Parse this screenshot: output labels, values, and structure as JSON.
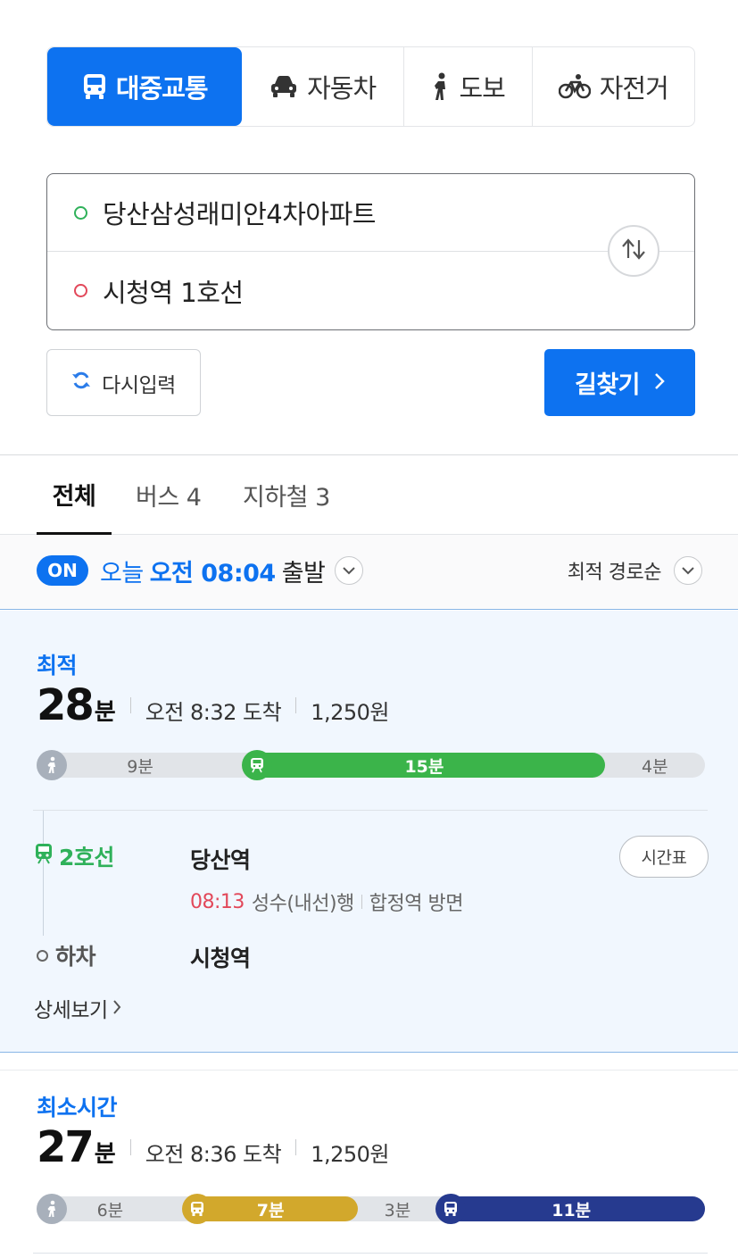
{
  "mode_tabs": [
    {
      "label": "대중교통",
      "icon": "bus-icon",
      "active": true
    },
    {
      "label": "자동차",
      "icon": "car-icon",
      "active": false
    },
    {
      "label": "도보",
      "icon": "walk-icon",
      "active": false
    },
    {
      "label": "자전거",
      "icon": "bicycle-icon",
      "active": false
    }
  ],
  "route": {
    "origin": "당산삼성래미안4차아파트",
    "destination": "시청역 1호선"
  },
  "buttons": {
    "reset": "다시입력",
    "search": "길찾기"
  },
  "result_tabs": [
    {
      "label": "전체",
      "active": true
    },
    {
      "label": "버스 4",
      "active": false
    },
    {
      "label": "지하철 3",
      "active": false
    }
  ],
  "departure": {
    "badge": "ON",
    "prefix": "오늘",
    "time": "오전 08:04",
    "suffix": "출발",
    "sort": "최적 경로순"
  },
  "routes": [
    {
      "label": "최적",
      "minutes": "28",
      "unit": "분",
      "arrival": "오전 8:32 도착",
      "fare": "1,250원",
      "segments": [
        {
          "mode": "walk",
          "label": "9분",
          "fraction": 0.31,
          "color": "#e1e4e8"
        },
        {
          "mode": "subway",
          "label": "15분",
          "fraction": 0.54,
          "color": "#3bb44a"
        },
        {
          "mode": "walk",
          "label": "4분",
          "fraction": 0.15,
          "color": "#e1e4e8"
        }
      ],
      "leg": {
        "line": "2호선",
        "line_color": "#2fb15a",
        "board_station": "당산역",
        "time": "08:13",
        "direction": "성수(내선)행",
        "platform": "합정역 방면",
        "timetable": "시간표",
        "alight_label": "하차",
        "alight_station": "시청역"
      },
      "detail_link": "상세보기"
    },
    {
      "label": "최소시간",
      "minutes": "27",
      "unit": "분",
      "arrival": "오전 8:36 도착",
      "fare": "1,250원",
      "segments": [
        {
          "mode": "walk",
          "label": "6분",
          "fraction": 0.22,
          "color": "#e1e4e8"
        },
        {
          "mode": "bus",
          "label": "7분",
          "fraction": 0.26,
          "color": "#d2a82c"
        },
        {
          "mode": "walk",
          "label": "3분",
          "fraction": 0.12,
          "color": "#e1e4e8"
        },
        {
          "mode": "bus",
          "label": "11분",
          "fraction": 0.4,
          "color": "#263a8f"
        }
      ]
    }
  ]
}
